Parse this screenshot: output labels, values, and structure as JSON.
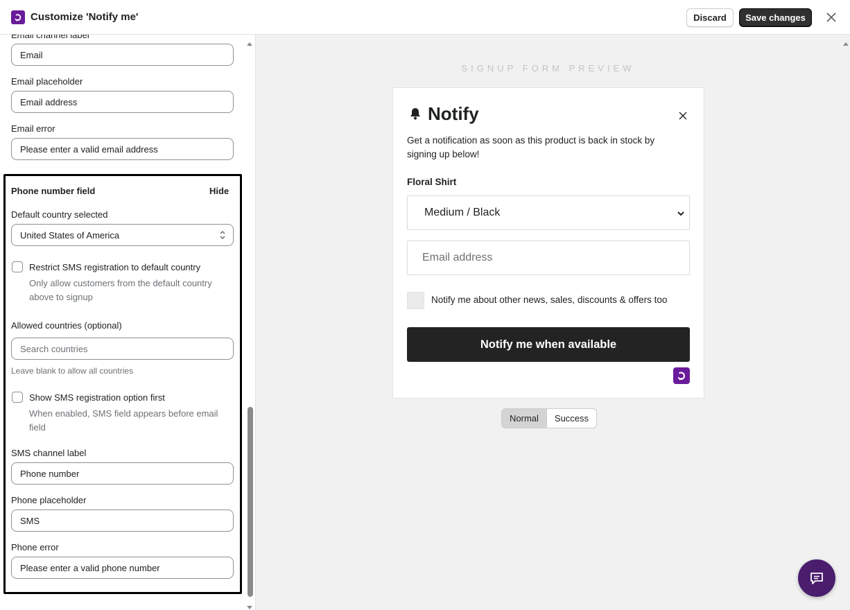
{
  "header": {
    "title": "Customize 'Notify me'",
    "discard_label": "Discard",
    "save_label": "Save changes"
  },
  "settings": {
    "email_channel_label": "Email channel label",
    "email_channel_value": "Email",
    "email_placeholder_label": "Email placeholder",
    "email_placeholder_value": "Email address",
    "email_error_label": "Email error",
    "email_error_value": "Please enter a valid email address",
    "phone_section": {
      "title": "Phone number field",
      "hide_label": "Hide",
      "default_country_label": "Default country selected",
      "default_country_value": "United States of America",
      "restrict_label": "Restrict SMS registration to default country",
      "restrict_checked": false,
      "restrict_help": "Only allow customers from the default country above to signup",
      "allowed_countries_label": "Allowed countries (optional)",
      "allowed_countries_placeholder": "Search countries",
      "allowed_countries_help": "Leave blank to allow all countries",
      "sms_first_label": "Show SMS registration option first",
      "sms_first_checked": false,
      "sms_first_help": "When enabled, SMS field appears before email field",
      "sms_channel_label": "SMS channel label",
      "sms_channel_value": "Phone number",
      "phone_placeholder_label": "Phone placeholder",
      "phone_placeholder_value": "SMS",
      "phone_error_label": "Phone error",
      "phone_error_value": "Please enter a valid phone number"
    }
  },
  "preview": {
    "heading": "SIGNUP FORM PREVIEW",
    "title": "Notify",
    "description": "Get a notification as soon as this product is back in stock by signing up below!",
    "product_name": "Floral Shirt",
    "variant_selected": "Medium / Black",
    "email_placeholder": "Email address",
    "marketing_label": "Notify me about other news, sales, discounts & offers too",
    "submit_label": "Notify me when available",
    "state_tabs": [
      "Normal",
      "Success"
    ],
    "active_state": "Normal"
  },
  "colors": {
    "brand": "#6a1b9a",
    "primary_button": "#303030",
    "preview_button": "#232323",
    "chat_button": "#4a1d6d",
    "preview_background": "#f1f1f1"
  },
  "icons": [
    "app-logo-icon",
    "close-icon",
    "select-arrows-icon",
    "bell-icon",
    "chevron-down-icon",
    "chat-icon",
    "scroll-up-arrow-icon",
    "scroll-down-arrow-icon"
  ]
}
